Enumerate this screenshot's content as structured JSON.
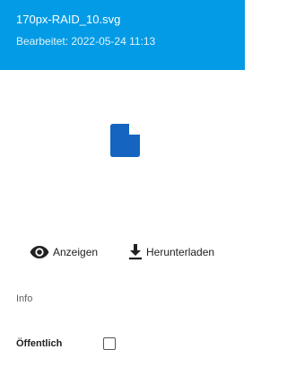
{
  "header": {
    "title": "170px-RAID_10.svg",
    "subtitle": "Bearbeitet: 2022-05-24 11:13",
    "background": "#039be5"
  },
  "preview": {
    "icon": "file-icon",
    "icon_color": "#1565c0"
  },
  "actions": {
    "view": {
      "icon": "eye-icon",
      "label": "Anzeigen"
    },
    "download": {
      "icon": "download-icon",
      "label": "Herunterladen"
    }
  },
  "info": {
    "section_label": "Info",
    "public": {
      "label": "Öffentlich",
      "checked": false
    }
  }
}
